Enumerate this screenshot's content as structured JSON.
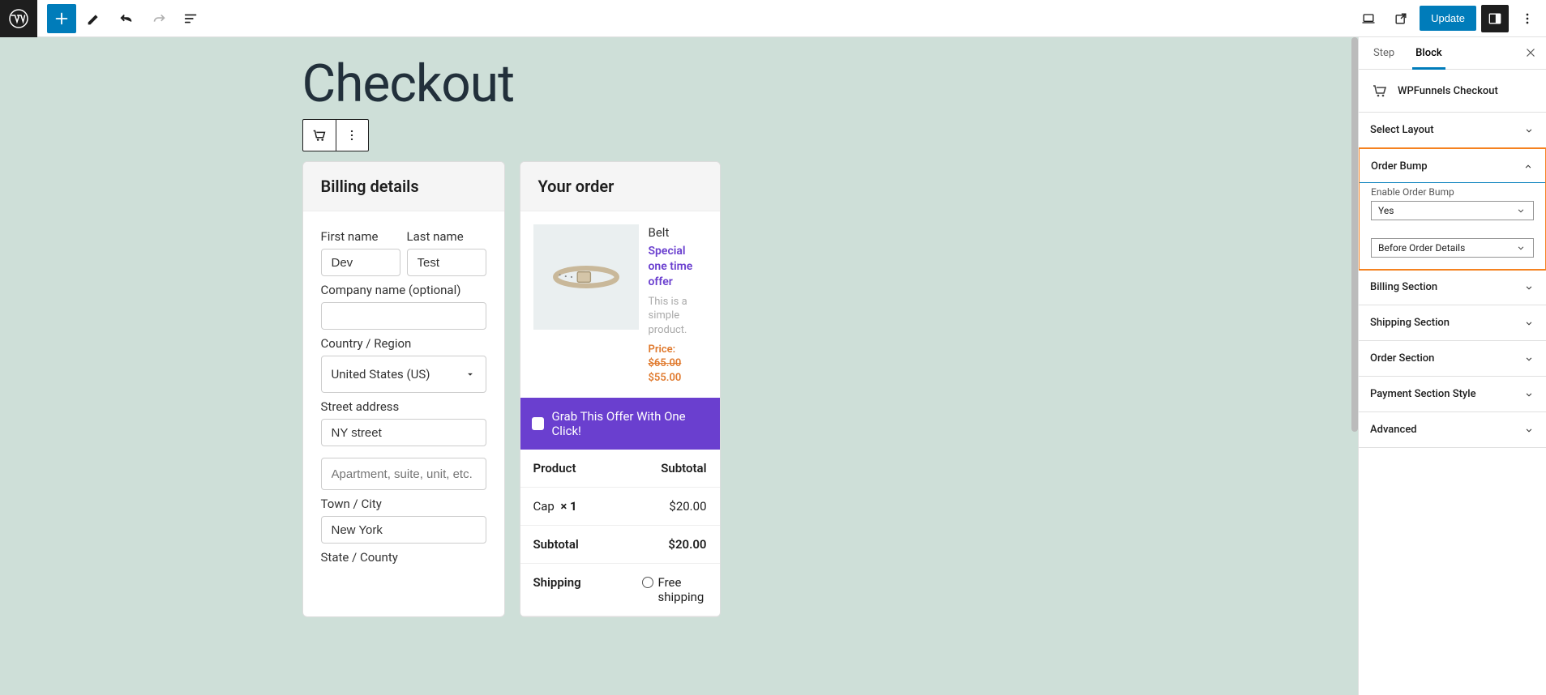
{
  "topbar": {
    "update_label": "Update"
  },
  "page": {
    "title": "Checkout"
  },
  "billing": {
    "heading": "Billing details",
    "first_name_label": "First name",
    "first_name_value": "Dev",
    "last_name_label": "Last name",
    "last_name_value": "Test",
    "company_label": "Company name (optional)",
    "company_value": "",
    "country_label": "Country / Region",
    "country_value": "United States (US)",
    "street_label": "Street address",
    "street1_value": "NY street",
    "street2_placeholder": "Apartment, suite, unit, etc. (o",
    "city_label": "Town / City",
    "city_value": "New York",
    "state_label": "State / County"
  },
  "order": {
    "heading": "Your order",
    "bump": {
      "name": "Belt",
      "offer": "Special one time offer",
      "desc": "This is a simple product.",
      "price_label": "Price:",
      "price_old": "$65.00",
      "price_new": "$55.00",
      "cta": "Grab This Offer With One Click!"
    },
    "table": {
      "product_hd": "Product",
      "subtotal_hd": "Subtotal",
      "item_name": "Cap",
      "item_qty": "× 1",
      "item_price": "$20.00",
      "subtotal_label": "Subtotal",
      "subtotal_value": "$20.00",
      "shipping_label": "Shipping",
      "shipping_option": "Free shipping"
    }
  },
  "sidebar": {
    "tab_step": "Step",
    "tab_block": "Block",
    "block_name": "WPFunnels Checkout",
    "panels": {
      "select_layout": "Select Layout",
      "order_bump": "Order Bump",
      "enable_label": "Enable Order Bump",
      "enable_value": "Yes",
      "position_value": "Before Order Details",
      "billing_section": "Billing Section",
      "shipping_section": "Shipping Section",
      "order_section": "Order Section",
      "payment_section": "Payment Section Style",
      "advanced": "Advanced"
    }
  }
}
